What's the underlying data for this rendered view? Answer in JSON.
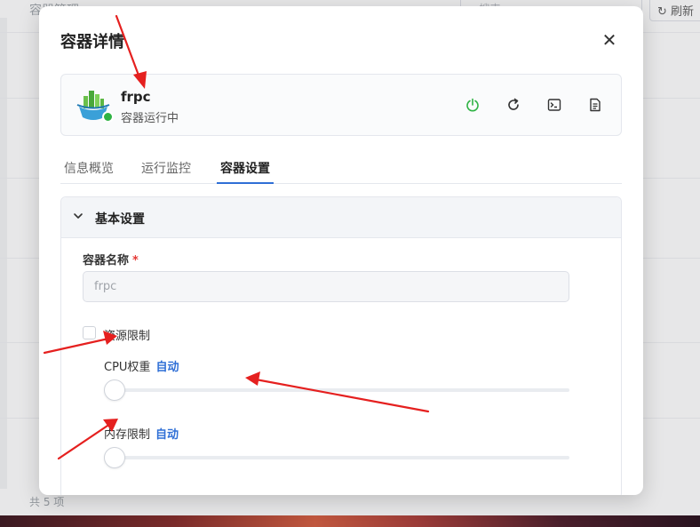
{
  "background": {
    "title": "容器管理",
    "search_placeholder": "搜索",
    "refresh_label": "刷新",
    "footer": "共 5 项"
  },
  "dialog": {
    "title": "容器详情",
    "close_glyph": "✕",
    "container": {
      "name": "frpc",
      "status": "容器运行中",
      "status_color": "#2fb344"
    },
    "actions": [
      {
        "icon": "power-icon",
        "color": "#2fb344"
      },
      {
        "icon": "restart-icon",
        "color": "#333333"
      },
      {
        "icon": "terminal-icon",
        "color": "#333333"
      },
      {
        "icon": "log-icon",
        "color": "#333333"
      }
    ],
    "tabs": [
      "信息概览",
      "运行监控",
      "容器设置"
    ],
    "active_tab": 2,
    "section": {
      "title": "基本设置",
      "name_label": "容器名称",
      "required_mark": "*",
      "name_value": "frpc",
      "resource_limit_label": "资源限制",
      "resource_limit_checked": false,
      "cpu_label": "CPU权重",
      "cpu_value": "自动",
      "cpu_level": 0,
      "memory_label": "内存限制",
      "memory_value": "自动",
      "memory_level": 0
    }
  },
  "colors": {
    "accent": "#2f6fd6",
    "annotation_arrow": "#e5201f"
  }
}
